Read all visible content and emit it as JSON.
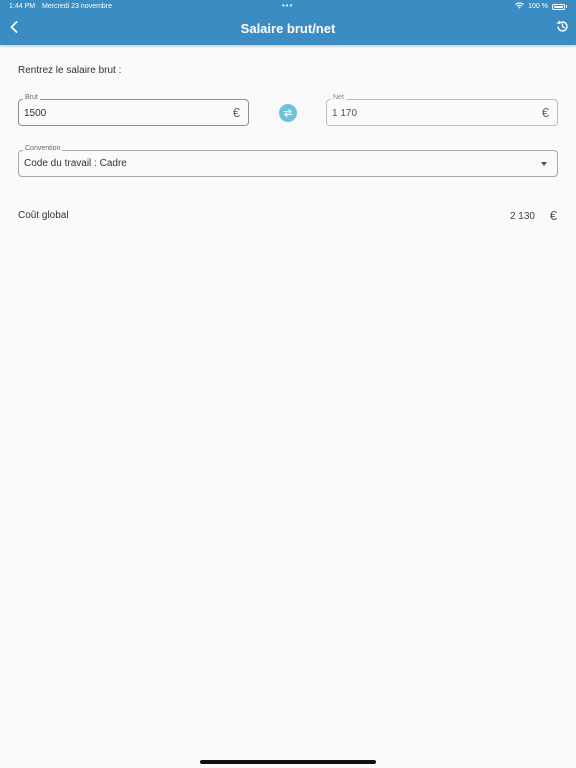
{
  "status_bar": {
    "time": "1:44 PM",
    "date": "Mercredi 23 novembre",
    "dots": "•••",
    "battery": "100 %"
  },
  "header": {
    "title": "Salaire brut/net",
    "back_icon": "chevron-left-icon",
    "reset_icon": "history-icon"
  },
  "form": {
    "prompt": "Rentrez le salaire brut :",
    "brut": {
      "label": "Brut",
      "value": "1500",
      "unit": "€"
    },
    "net": {
      "label": "Net",
      "value": "1 170",
      "unit": "€"
    },
    "convention": {
      "label": "Convention",
      "value": "Code du travail : Cadre"
    }
  },
  "result": {
    "label": "Coût global",
    "value": "2 130",
    "unit": "€"
  },
  "colors": {
    "header": "#3a8cc3",
    "swap": "#6cc0e0",
    "background": "#fafafa"
  }
}
